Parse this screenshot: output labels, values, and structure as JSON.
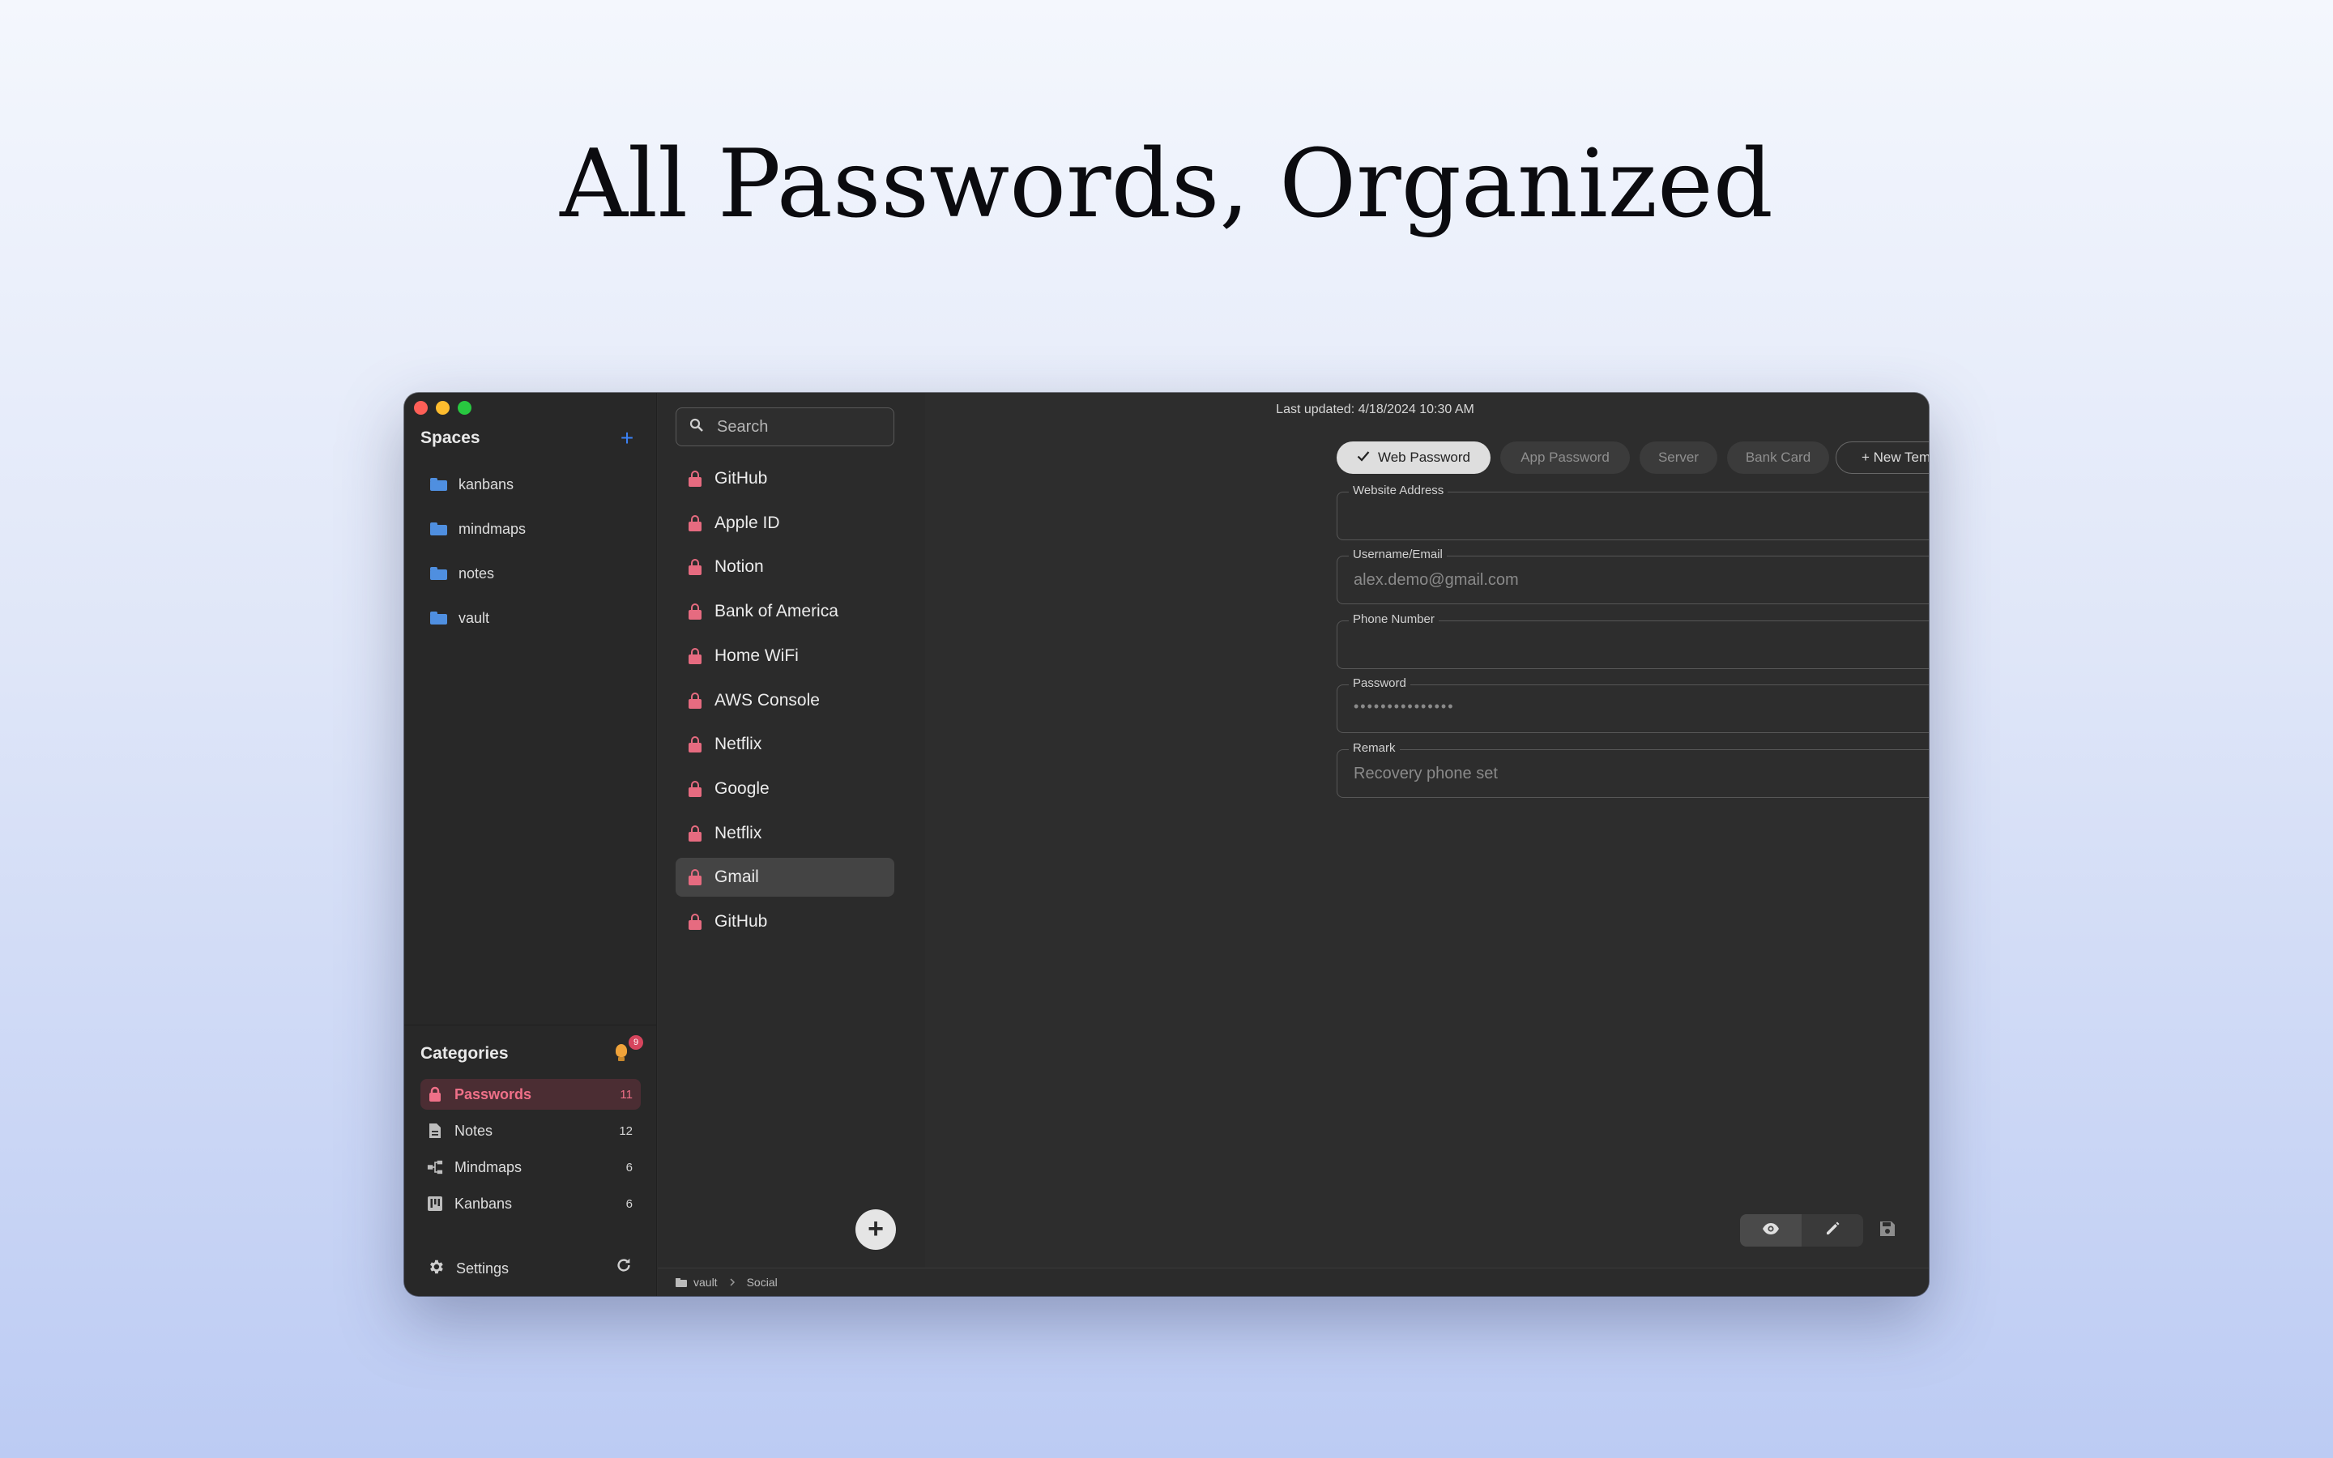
{
  "headline": "All Passwords, Organized",
  "sidebar": {
    "spaces_title": "Spaces",
    "add_space": "+",
    "spaces": [
      {
        "label": "kanbans"
      },
      {
        "label": "mindmaps"
      },
      {
        "label": "notes"
      },
      {
        "label": "vault"
      }
    ],
    "categories_title": "Categories",
    "tips_badge": "9",
    "categories": [
      {
        "label": "Passwords",
        "count": "11",
        "icon": "lock-icon"
      },
      {
        "label": "Notes",
        "count": "12",
        "icon": "document-icon"
      },
      {
        "label": "Mindmaps",
        "count": "6",
        "icon": "mindmap-icon"
      },
      {
        "label": "Kanbans",
        "count": "6",
        "icon": "kanban-icon"
      }
    ],
    "settings_label": "Settings"
  },
  "list": {
    "search_placeholder": "Search",
    "items": [
      {
        "label": "GitHub"
      },
      {
        "label": "Apple ID"
      },
      {
        "label": "Notion"
      },
      {
        "label": "Bank of America"
      },
      {
        "label": "Home WiFi"
      },
      {
        "label": "AWS Console"
      },
      {
        "label": "Netflix"
      },
      {
        "label": "Google"
      },
      {
        "label": "Netflix"
      },
      {
        "label": "Gmail"
      },
      {
        "label": "GitHub"
      }
    ],
    "selected_index": 9
  },
  "detail": {
    "last_updated": "Last updated: 4/18/2024 10:30 AM",
    "tabs": [
      {
        "label": "Web Password",
        "active": true
      },
      {
        "label": "App Password",
        "active": false
      },
      {
        "label": "Server",
        "active": false
      },
      {
        "label": "Bank Card",
        "active": false
      }
    ],
    "new_template": "+ New Template",
    "fields": {
      "website_label": "Website Address",
      "website_value": "",
      "username_label": "Username/Email",
      "username_value": "alex.demo@gmail.com",
      "phone_label": "Phone Number",
      "phone_value": "",
      "password_label": "Password",
      "password_value": "•••••••••••••••",
      "remark_label": "Remark",
      "remark_value": "Recovery phone set"
    }
  },
  "statusbar": {
    "space": "vault",
    "folder": "Social"
  },
  "colors": {
    "accent_blue": "#3b82f6",
    "lock_red": "#e66b80",
    "active_category_bg": "#4b2d33"
  }
}
